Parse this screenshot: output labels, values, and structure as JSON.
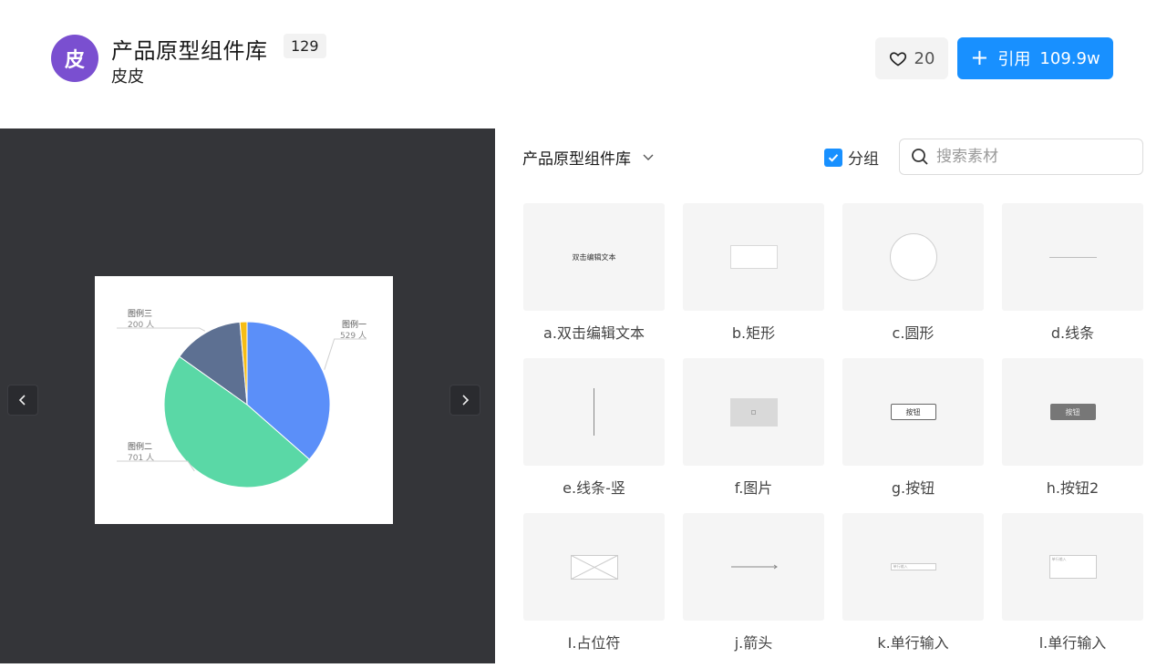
{
  "header": {
    "avatar_text": "皮",
    "title": "产品原型组件库",
    "count": "129",
    "author": "皮皮",
    "likes": "20",
    "use_label": "引用",
    "use_count": "109.9w",
    "accent_color": "#1890ff",
    "avatar_color": "#7a4fd0"
  },
  "preview": {
    "chart_data": {
      "type": "pie",
      "slices": [
        {
          "name": "图例一",
          "value": 529,
          "label": "529 人",
          "color": "#5b8ff9"
        },
        {
          "name": "图例二",
          "value": 701,
          "label": "701 人",
          "color": "#5ad8a6"
        },
        {
          "name": "图例三",
          "value": 200,
          "label": "200 人",
          "color": "#5d7092"
        },
        {
          "name": "",
          "value": 20,
          "label": "",
          "color": "#f6bd16"
        }
      ]
    },
    "prev_icon": "chevron-left-icon",
    "next_icon": "chevron-right-icon"
  },
  "toolbar": {
    "library": "产品原型组件库",
    "group_label": "分组",
    "group_checked": true,
    "search_placeholder": "搜索素材"
  },
  "assets": [
    {
      "label": "a.双击编辑文本",
      "kind": "text",
      "thumb_text": "双击编辑文本"
    },
    {
      "label": "b.矩形",
      "kind": "rect"
    },
    {
      "label": "c.圆形",
      "kind": "circle"
    },
    {
      "label": "d.线条",
      "kind": "line"
    },
    {
      "label": "e.线条-竖",
      "kind": "vline"
    },
    {
      "label": "f.图片",
      "kind": "image"
    },
    {
      "label": "g.按钮",
      "kind": "button",
      "thumb_text": "按钮"
    },
    {
      "label": "h.按钮2",
      "kind": "button2",
      "thumb_text": "按钮"
    },
    {
      "label": "I.占位符",
      "kind": "placeholder"
    },
    {
      "label": "j.箭头",
      "kind": "arrow"
    },
    {
      "label": "k.单行输入",
      "kind": "input",
      "thumb_text": "单行输入"
    },
    {
      "label": "l.单行输入",
      "kind": "textarea",
      "thumb_text": "单行输入"
    }
  ]
}
